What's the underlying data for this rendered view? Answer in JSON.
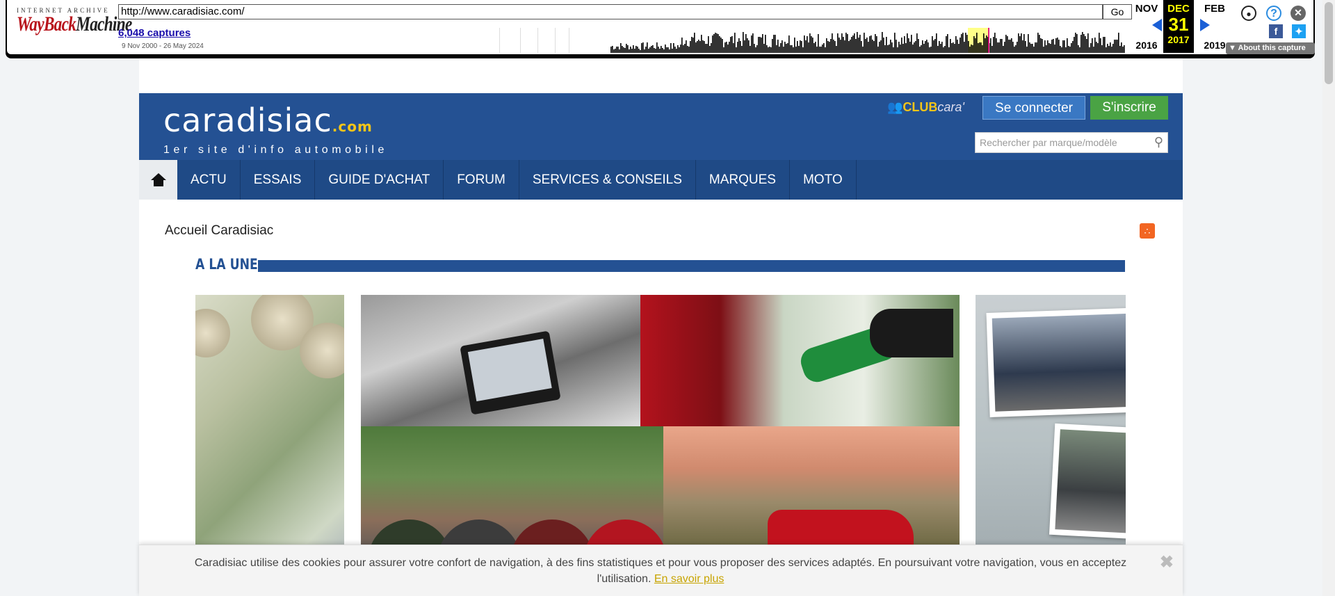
{
  "wayback": {
    "ia_label": "INTERNET ARCHIVE",
    "logo_wayback": "WayBack",
    "logo_machine": "Machine",
    "url": "http://www.caradisiac.com/",
    "go_label": "Go",
    "captures": "6,048 captures",
    "range": "9 Nov 2000 - 26 May 2024",
    "prev_month": "NOV",
    "prev_year": "2016",
    "cur_month": "DEC",
    "cur_day": "31",
    "cur_year": "2017",
    "next_month": "FEB",
    "next_year": "2019",
    "about": "About this capture"
  },
  "header": {
    "brand_name": "caradisiac",
    "brand_tld": ".com",
    "tagline": "1er site d'info automobile",
    "club_a": "CLUB",
    "club_b": "cara'",
    "login": "Se connecter",
    "signup": "S'inscrire",
    "search_placeholder": "Rechercher par marque/modèle"
  },
  "nav": {
    "items": [
      "ACTU",
      "ESSAIS",
      "GUIDE D'ACHAT",
      "FORUM",
      "SERVICES & CONSEILS",
      "MARQUES",
      "MOTO"
    ]
  },
  "main": {
    "breadcrumb": "Accueil Caradisiac",
    "section_title": "A LA UNE"
  },
  "cookie": {
    "text": "Caradisiac utilise des cookies pour assurer votre confort de navigation, à des fins statistiques et pour vous proposer des services adaptés. En poursuivant votre navigation, vous en acceptez l'utilisation.",
    "link": "En savoir plus"
  },
  "colors": {
    "brand_blue": "#245193",
    "nav_blue": "#1f4a86",
    "signup_green": "#4aa344",
    "wayback_highlight": "#ffff00"
  }
}
